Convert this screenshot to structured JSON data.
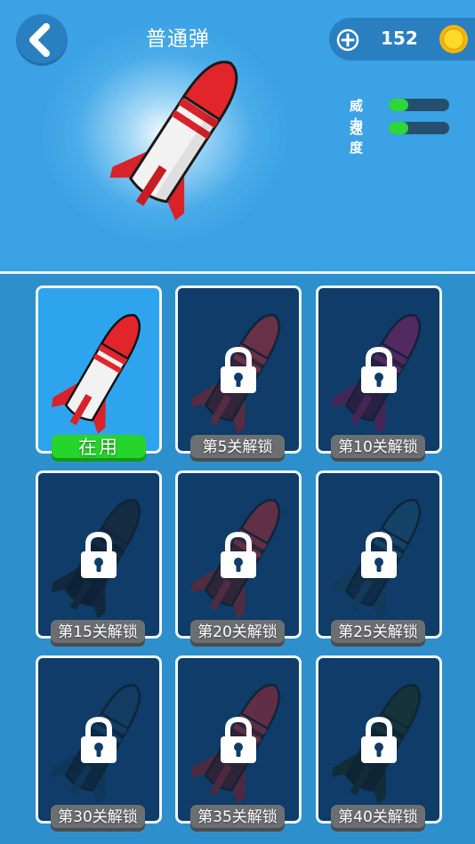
{
  "header": {
    "title": "普通弹",
    "coins": "152",
    "back_icon": "back-arrow-icon",
    "add_icon": "plus-icon",
    "coin_icon": "gold-coin-icon"
  },
  "stats": [
    {
      "label": "威力",
      "level": 0.33
    },
    {
      "label": "速度",
      "level": 0.33
    }
  ],
  "colors": {
    "header_bg": "#3aa2e5",
    "grid_bg": "#2d8fcc",
    "card_locked_bg": "#0f3c68",
    "card_active_bg": "#2ea4ee",
    "in_use_green": "#25d52b",
    "locked_label_gray": "#6c6f72",
    "stat_fill_green": "#2fd63a"
  },
  "missiles": [
    {
      "status": "在用",
      "locked": false,
      "color": "#e0262b"
    },
    {
      "status": "第5关解锁",
      "locked": true,
      "color": "#b3282c"
    },
    {
      "status": "第10关解锁",
      "locked": true,
      "color": "#8a1a5a"
    },
    {
      "status": "第15关解锁",
      "locked": true,
      "color": "#1b1e22"
    },
    {
      "status": "第20关解锁",
      "locked": true,
      "color": "#a8272a"
    },
    {
      "status": "第25关解锁",
      "locked": true,
      "color": "#1c4a66"
    },
    {
      "status": "第30关解锁",
      "locked": true,
      "color": "#163e5e"
    },
    {
      "status": "第35关解锁",
      "locked": true,
      "color": "#a3242a"
    },
    {
      "status": "第40关解锁",
      "locked": true,
      "color": "#1c2a16"
    }
  ]
}
